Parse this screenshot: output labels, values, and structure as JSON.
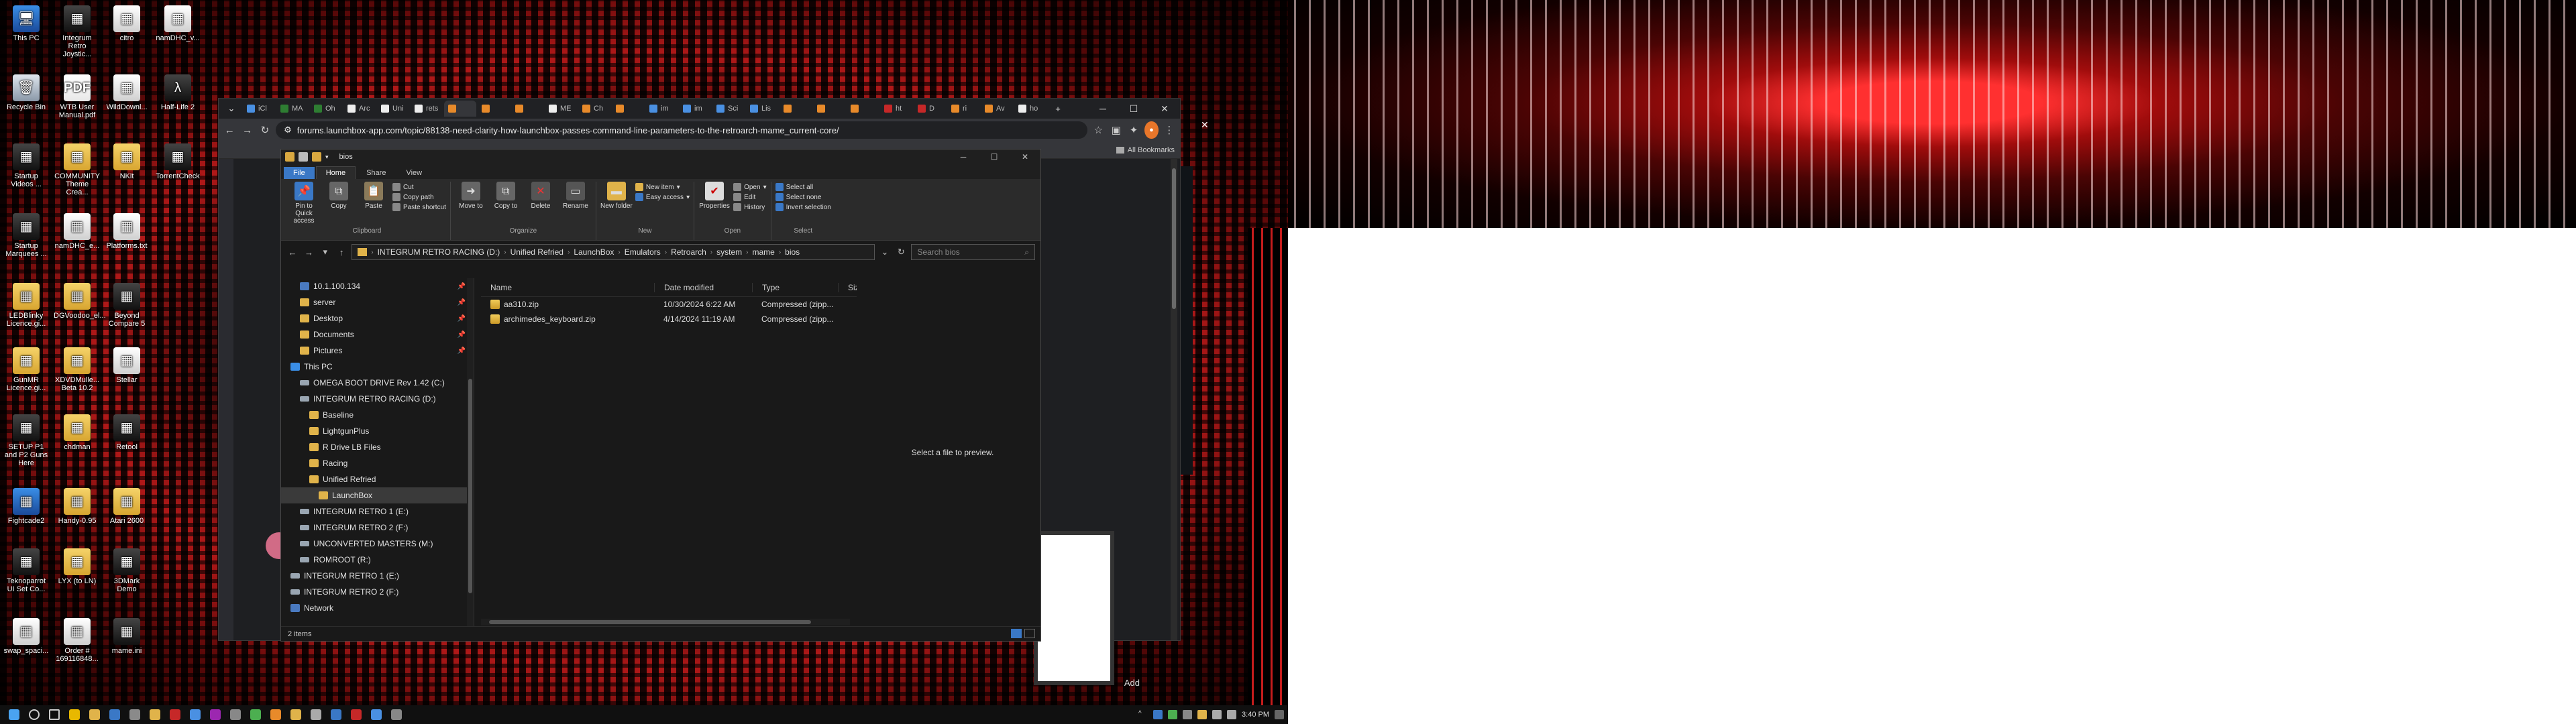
{
  "desktop": {
    "icons": [
      {
        "label": "This PC",
        "glyph": "🖥",
        "kind": "pc",
        "col": 0,
        "row": 0
      },
      {
        "label": "Recycle Bin",
        "glyph": "🗑",
        "kind": "bin",
        "col": 0,
        "row": 1
      },
      {
        "label": "Startup Videos ...",
        "glyph": "▦",
        "kind": "app",
        "col": 0,
        "row": 2
      },
      {
        "label": "Startup Marquees ...",
        "glyph": "▦",
        "kind": "app",
        "col": 0,
        "row": 3
      },
      {
        "label": "LEDBlinky Licence.gi...",
        "glyph": "▦",
        "kind": "folder",
        "col": 0,
        "row": 4
      },
      {
        "label": "GunMR Licence.gi...",
        "glyph": "▦",
        "kind": "folder",
        "col": 0,
        "row": 5
      },
      {
        "label": "SETUP P1 and P2 Guns Here",
        "glyph": "▦",
        "kind": "app",
        "col": 0,
        "row": 6
      },
      {
        "label": "Fightcade2",
        "glyph": "▦",
        "kind": "pc",
        "col": 0,
        "row": 7
      },
      {
        "label": "Teknoparrot UI Set Co...",
        "glyph": "▦",
        "kind": "app",
        "col": 0,
        "row": 8
      },
      {
        "label": "swap_spaci...",
        "glyph": "▦",
        "kind": "doc",
        "col": 0,
        "row": 9
      },
      {
        "label": "Integrum Retro Joystic...",
        "glyph": "▦",
        "kind": "app",
        "col": 1,
        "row": 0
      },
      {
        "label": "WTB User Manual.pdf",
        "glyph": "PDF",
        "kind": "pdf",
        "col": 1,
        "row": 1
      },
      {
        "label": "COMMUNITY Theme Crea...",
        "glyph": "▦",
        "kind": "folder",
        "col": 1,
        "row": 2
      },
      {
        "label": "namDHC_e...",
        "glyph": "▦",
        "kind": "doc",
        "col": 1,
        "row": 3
      },
      {
        "label": "DGVoodoo_el...",
        "glyph": "▦",
        "kind": "folder",
        "col": 1,
        "row": 4
      },
      {
        "label": "XDVDMulle... Beta 10.2",
        "glyph": "▦",
        "kind": "folder",
        "col": 1,
        "row": 5
      },
      {
        "label": "chdman",
        "glyph": "▦",
        "kind": "folder",
        "col": 1,
        "row": 6
      },
      {
        "label": "Handy-0.95",
        "glyph": "▦",
        "kind": "folder",
        "col": 1,
        "row": 7
      },
      {
        "label": "LYX (to LN)",
        "glyph": "▦",
        "kind": "folder",
        "col": 1,
        "row": 8
      },
      {
        "label": "Order # 169116848...",
        "glyph": "▦",
        "kind": "doc",
        "col": 1,
        "row": 9
      },
      {
        "label": "citro",
        "glyph": "▦",
        "kind": "doc",
        "col": 2,
        "row": 0
      },
      {
        "label": "WildDownl...",
        "glyph": "▦",
        "kind": "doc",
        "col": 2,
        "row": 1
      },
      {
        "label": "NKit",
        "glyph": "▦",
        "kind": "folder",
        "col": 2,
        "row": 2
      },
      {
        "label": "Platforms.txt",
        "glyph": "▦",
        "kind": "doc",
        "col": 2,
        "row": 3
      },
      {
        "label": "Beyond Compare 5",
        "glyph": "▦",
        "kind": "app",
        "col": 2,
        "row": 4
      },
      {
        "label": "Stellar",
        "glyph": "▦",
        "kind": "doc",
        "col": 2,
        "row": 5
      },
      {
        "label": "Retool",
        "glyph": "▦",
        "kind": "app",
        "col": 2,
        "row": 6
      },
      {
        "label": "Atari 2600",
        "glyph": "▦",
        "kind": "folder",
        "col": 2,
        "row": 7
      },
      {
        "label": "3DMark Demo",
        "glyph": "▦",
        "kind": "app",
        "col": 2,
        "row": 8
      },
      {
        "label": "mame.ini",
        "glyph": "▦",
        "kind": "app",
        "col": 2,
        "row": 9
      },
      {
        "label": "namDHC_v...",
        "glyph": "▦",
        "kind": "doc",
        "col": 3,
        "row": 0
      },
      {
        "label": "Half-Life 2",
        "glyph": "λ",
        "kind": "app",
        "col": 3,
        "row": 1
      },
      {
        "label": "TorrentCheck",
        "glyph": "▦",
        "kind": "app",
        "col": 3,
        "row": 2
      }
    ]
  },
  "chrome": {
    "tabs": [
      {
        "label": "iCl",
        "color": "#4a90e2"
      },
      {
        "label": "MA",
        "color": "#2e7d32"
      },
      {
        "label": "Oh",
        "color": "#2e7d32"
      },
      {
        "label": "Arc",
        "color": "#eeeeee"
      },
      {
        "label": "Uni",
        "color": "#eeeeee"
      },
      {
        "label": "rets",
        "color": "#eeeeee"
      },
      {
        "label": "",
        "color": "#e88a2a"
      },
      {
        "label": "",
        "color": "#e88a2a"
      },
      {
        "label": "",
        "color": "#e88a2a"
      },
      {
        "label": "ME",
        "color": "#eeeeee"
      },
      {
        "label": "Ch",
        "color": "#e88a2a"
      },
      {
        "label": "",
        "color": "#e88a2a"
      },
      {
        "label": "im",
        "color": "#4a90e2"
      },
      {
        "label": "im",
        "color": "#4a90e2"
      },
      {
        "label": "Sci",
        "color": "#4a90e2"
      },
      {
        "label": "Lis",
        "color": "#4a90e2"
      },
      {
        "label": "",
        "color": "#e88a2a"
      },
      {
        "label": "",
        "color": "#e88a2a"
      },
      {
        "label": "",
        "color": "#e88a2a"
      },
      {
        "label": "ht",
        "color": "#c62828"
      },
      {
        "label": "D",
        "color": "#c62828"
      },
      {
        "label": "ri",
        "color": "#e88a2a"
      },
      {
        "label": "Av",
        "color": "#e88a2a"
      },
      {
        "label": "ho",
        "color": "#eeeeee"
      }
    ],
    "url": "forums.launchbox-app.com/topic/88138-need-clarity-how-launchbox-passes-command-line-parameters-to-the-retroarch-mame_current-core/",
    "bookmarks_label": "All Bookmarks",
    "page_add_label": "Add"
  },
  "explorer": {
    "title": "bios",
    "ribbon_tabs": [
      "File",
      "Home",
      "Share",
      "View"
    ],
    "ribbon": {
      "clipboard": {
        "label": "Clipboard",
        "pin": "Pin to Quick access",
        "copy": "Copy",
        "paste": "Paste",
        "cut": "Cut",
        "copy_path": "Copy path",
        "paste_shortcut": "Paste shortcut"
      },
      "organize": {
        "label": "Organize",
        "move_to": "Move to",
        "copy_to": "Copy to",
        "delete": "Delete",
        "rename": "Rename"
      },
      "new": {
        "label": "New",
        "new_folder": "New folder",
        "new_item": "New item",
        "easy_access": "Easy access"
      },
      "open": {
        "label": "Open",
        "properties": "Properties",
        "open": "Open",
        "edit": "Edit",
        "history": "History"
      },
      "select": {
        "label": "Select",
        "select_all": "Select all",
        "select_none": "Select none",
        "invert": "Invert selection"
      }
    },
    "breadcrumb": [
      "INTEGRUM RETRO RACING (D:)",
      "Unified Refried",
      "LaunchBox",
      "Emulators",
      "Retroarch",
      "system",
      "mame",
      "bios"
    ],
    "search_placeholder": "Search bios",
    "nav": [
      {
        "label": "10.1.100.134",
        "type": "net",
        "indent": 1,
        "pin": true
      },
      {
        "label": "server",
        "type": "folder",
        "indent": 1,
        "pin": true
      },
      {
        "label": "Desktop",
        "type": "folder",
        "indent": 1,
        "pin": true
      },
      {
        "label": "Documents",
        "type": "folder",
        "indent": 1,
        "pin": true
      },
      {
        "label": "Pictures",
        "type": "folder",
        "indent": 1,
        "pin": true
      },
      {
        "label": "This PC",
        "type": "pc",
        "indent": 0,
        "pin": false
      },
      {
        "label": "OMEGA BOOT DRIVE Rev 1.42 (C:)",
        "type": "drive",
        "indent": 1,
        "pin": false
      },
      {
        "label": "INTEGRUM RETRO RACING (D:)",
        "type": "drive",
        "indent": 1,
        "pin": false
      },
      {
        "label": "Baseline",
        "type": "folder",
        "indent": 2,
        "pin": false
      },
      {
        "label": "LightgunPlus",
        "type": "folder",
        "indent": 2,
        "pin": false
      },
      {
        "label": "R Drive LB Files",
        "type": "folder",
        "indent": 2,
        "pin": false
      },
      {
        "label": "Racing",
        "type": "folder",
        "indent": 2,
        "pin": false
      },
      {
        "label": "Unified Refried",
        "type": "folder",
        "indent": 2,
        "pin": false
      },
      {
        "label": "LaunchBox",
        "type": "folder",
        "indent": 3,
        "pin": false,
        "selected": true
      },
      {
        "label": "INTEGRUM RETRO 1 (E:)",
        "type": "drive",
        "indent": 1,
        "pin": false
      },
      {
        "label": "INTEGRUM RETRO 2 (F:)",
        "type": "drive",
        "indent": 1,
        "pin": false
      },
      {
        "label": "UNCONVERTED MASTERS (M:)",
        "type": "drive",
        "indent": 1,
        "pin": false
      },
      {
        "label": "ROMROOT (R:)",
        "type": "drive",
        "indent": 1,
        "pin": false
      },
      {
        "label": "INTEGRUM RETRO 1 (E:)",
        "type": "drive",
        "indent": 0,
        "pin": false
      },
      {
        "label": "INTEGRUM RETRO 2 (F:)",
        "type": "drive",
        "indent": 0,
        "pin": false
      },
      {
        "label": "Network",
        "type": "net",
        "indent": 0,
        "pin": false
      }
    ],
    "columns": {
      "name": "Name",
      "date": "Date modified",
      "type": "Type",
      "size": "Size"
    },
    "files": [
      {
        "name": "aa310.zip",
        "date": "10/30/2024 6:22 AM",
        "type": "Compressed (zipp..."
      },
      {
        "name": "archimedes_keyboard.zip",
        "date": "4/14/2024 11:19 AM",
        "type": "Compressed (zipp..."
      }
    ],
    "preview_text": "Select a file to preview.",
    "status": "2 items"
  },
  "taskbar": {
    "icons": [
      {
        "name": "start",
        "color": "#4aa3f0"
      },
      {
        "name": "search",
        "color": "#cccccc"
      },
      {
        "name": "task-view",
        "color": "#cccccc"
      },
      {
        "name": "chrome",
        "color": "#e8b800"
      },
      {
        "name": "explorer",
        "color": "#e0b34a"
      },
      {
        "name": "app3",
        "color": "#3a78c6"
      },
      {
        "name": "app4",
        "color": "#8a8a8a"
      },
      {
        "name": "app5",
        "color": "#e0b34a"
      },
      {
        "name": "app6",
        "color": "#c62828"
      },
      {
        "name": "app7",
        "color": "#4a90e2"
      },
      {
        "name": "app8",
        "color": "#9c27b0"
      },
      {
        "name": "app9",
        "color": "#888888"
      },
      {
        "name": "app10",
        "color": "#4caf50"
      },
      {
        "name": "app11",
        "color": "#e88a2a"
      },
      {
        "name": "app12",
        "color": "#e0b34a"
      },
      {
        "name": "app13",
        "color": "#aaaaaa"
      },
      {
        "name": "app14",
        "color": "#3a78c6"
      },
      {
        "name": "app15",
        "color": "#c62828"
      },
      {
        "name": "app16",
        "color": "#4a90e2"
      },
      {
        "name": "app17",
        "color": "#888888"
      }
    ],
    "clock": "3:40 PM"
  }
}
